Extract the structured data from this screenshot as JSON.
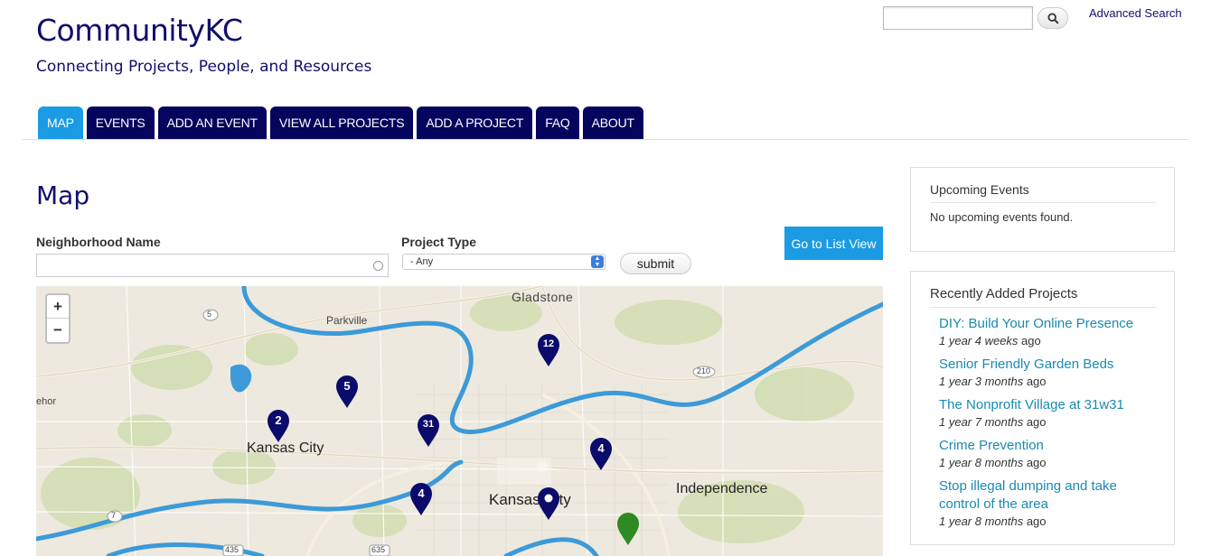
{
  "site": {
    "title": "CommunityKC",
    "slogan": "Connecting Projects, People, and Resources"
  },
  "search": {
    "value": "",
    "placeholder": "",
    "advanced_label": "Advanced Search"
  },
  "nav": {
    "tabs": [
      "MAP",
      "EVENTS",
      "ADD AN EVENT",
      "VIEW ALL PROJECTS",
      "ADD A PROJECT",
      "FAQ",
      "ABOUT"
    ],
    "active": "MAP"
  },
  "main": {
    "title": "Map",
    "filters": {
      "neighborhood_label": "Neighborhood Name",
      "neighborhood_value": "",
      "project_type_label": "Project Type",
      "project_type_value": "- Any",
      "submit_label": "submit"
    },
    "list_view_label": "Go to List View"
  },
  "map": {
    "zoom_in": "+",
    "zoom_out": "−",
    "labels": {
      "gladstone": "Gladstone",
      "parkville": "Parkville",
      "kansas_city_ks": "Kansas City",
      "kansas_city_mo": "Kansas City",
      "independence": "Independence",
      "riverside_fragment": "ehor",
      "route_5": "5",
      "route_210": "210",
      "route_7": "7",
      "route_435": "435",
      "route_635": "635"
    },
    "markers": [
      {
        "count": "12",
        "color": "#0b0b6b"
      },
      {
        "count": "5",
        "color": "#0b0b6b"
      },
      {
        "count": "2",
        "color": "#0b0b6b"
      },
      {
        "count": "31",
        "color": "#0b0b6b"
      },
      {
        "count": "4",
        "color": "#0b0b6b"
      },
      {
        "count": "4",
        "color": "#0b0b6b"
      },
      {
        "count": "",
        "color": "#0b0b6b",
        "icon": "pin-dot-icon"
      },
      {
        "count": "",
        "color": "#2e8b23",
        "icon": "green-pin-icon"
      }
    ]
  },
  "sidebar": {
    "events": {
      "title": "Upcoming Events",
      "empty": "No upcoming events found."
    },
    "projects": {
      "title": "Recently Added Projects",
      "items": [
        {
          "title": "DIY: Build Your Online Presence",
          "age": "1 year 4 weeks",
          "suffix": " ago"
        },
        {
          "title": "Senior Friendly Garden Beds",
          "age": "1 year 3 months",
          "suffix": " ago"
        },
        {
          "title": "The Nonprofit Village at 31w31",
          "age": "1 year 7 months",
          "suffix": " ago"
        },
        {
          "title": "Crime Prevention",
          "age": "1 year 8 months",
          "suffix": " ago"
        },
        {
          "title": "Stop illegal dumping and take control of the area",
          "age": "1 year 8 months",
          "suffix": " ago"
        }
      ]
    }
  },
  "colors": {
    "brand_navy": "#0f0f6e",
    "tab_navy": "#05055e",
    "accent_blue": "#1a9be3",
    "link_teal": "#1a8ab0",
    "river": "#3d9ad8"
  }
}
